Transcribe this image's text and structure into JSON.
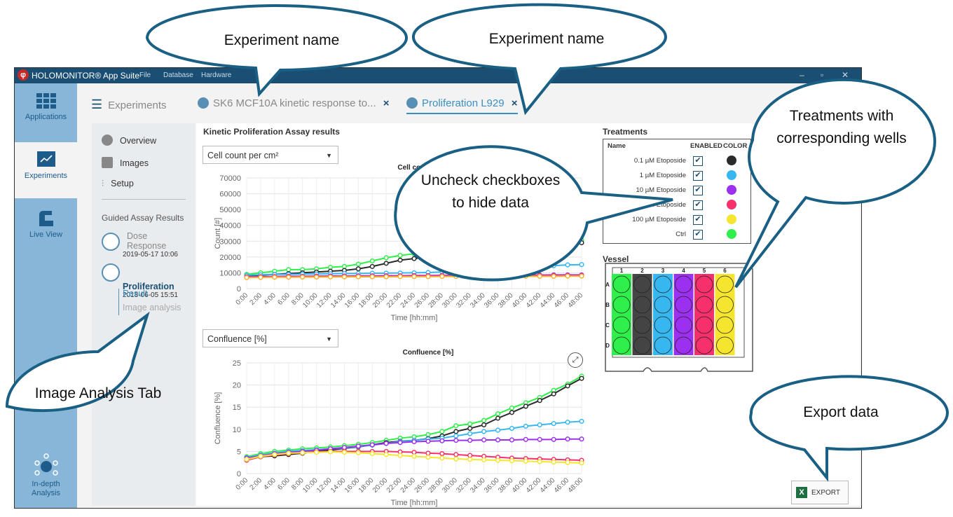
{
  "window": {
    "app_title": "HOLOMONITOR® App Suite",
    "menu": [
      "File",
      "Database",
      "Hardware"
    ]
  },
  "left_nav": [
    {
      "label": "Applications",
      "icon": "grid-icon"
    },
    {
      "label": "Experiments",
      "icon": "chart-icon"
    },
    {
      "label": "Live View",
      "icon": "microscope-icon"
    },
    {
      "label": "In-depth Analysis",
      "icon": "network-icon"
    }
  ],
  "tabs": {
    "experiments": "Experiments",
    "tab1": "SK6 MCF10A kinetic response to...",
    "tab2": "Proliferation L929",
    "close": "×"
  },
  "sidebar": {
    "overview": "Overview",
    "images": "Images",
    "setup": "Setup",
    "guided_heading": "Guided Assay Results",
    "dose_title": "Dose Response",
    "dose_date": "2019-05-17 10:06",
    "prolif_title": "Proliferation",
    "prolif_date": "2018-06-05 15:51",
    "result": "Result",
    "image_analysis": "Image analysis"
  },
  "main": {
    "heading": "Kinetic Proliferation Assay results",
    "select1": "Cell count per cm²",
    "select2": "Confluence [%]",
    "export_label": "EXPORT",
    "export_icon": "X"
  },
  "treatments": {
    "title": "Treatments",
    "col_name": "Name",
    "col_enabled": "ENABLED",
    "col_color": "COLOR",
    "rows": [
      {
        "name": "0.1 µM Etoposide",
        "enabled": true,
        "color": "#2a2a2a"
      },
      {
        "name": "1 µM Etoposide",
        "enabled": true,
        "color": "#37b7f0"
      },
      {
        "name": "10 µM Etoposide",
        "enabled": true,
        "color": "#9c30f0"
      },
      {
        "name": "50 µM Etoposide",
        "enabled": true,
        "color": "#f5306a"
      },
      {
        "name": "100 µM Etoposide",
        "enabled": true,
        "color": "#f5e52f"
      },
      {
        "name": "Ctrl",
        "enabled": true,
        "color": "#2ff04a"
      }
    ],
    "check": "✔"
  },
  "vessel": {
    "title": "Vessel",
    "cols": [
      "1",
      "2",
      "3",
      "4",
      "5",
      "6"
    ],
    "rows": [
      "A",
      "B",
      "C",
      "D"
    ],
    "col_colors": [
      "#2ff04a",
      "#444444",
      "#37b7f0",
      "#9c30f0",
      "#f5306a",
      "#f5e52f"
    ]
  },
  "callouts": {
    "exp_name_1": "Experiment name",
    "exp_name_2": "Experiment name",
    "treatments": "Treatments with corresponding wells",
    "uncheck": "Uncheck checkboxes to hide data",
    "image_tab": "Image Analysis Tab",
    "export": "Export data"
  },
  "chart_data": [
    {
      "type": "line",
      "title": "Cell count per cm²",
      "xlabel": "Time [hh:mm]",
      "ylabel": "Count [#]",
      "ylim": [
        0,
        70000
      ],
      "yticks": [
        0,
        10000,
        20000,
        30000,
        40000,
        50000,
        60000,
        70000
      ],
      "categories": [
        "0:00",
        "2:00",
        "4:00",
        "6:00",
        "8:00",
        "10:00",
        "12:00",
        "14:00",
        "16:00",
        "18:00",
        "20:00",
        "22:00",
        "24:00",
        "26:00",
        "28:00",
        "30:00",
        "32:00",
        "34:00",
        "36:00",
        "38:00",
        "40:00",
        "42:00",
        "44:00",
        "46:00",
        "48:00"
      ],
      "series": [
        {
          "name": "Ctrl",
          "color": "#2ff04a",
          "values": [
            9000,
            10000,
            11000,
            12000,
            12000,
            12500,
            13500,
            14000,
            15500,
            17500,
            19500,
            21000,
            22000,
            23000,
            24000,
            25000,
            26000,
            27000,
            27500,
            28000,
            28500,
            29000,
            29500,
            30000,
            30500
          ]
        },
        {
          "name": "0.1 µM Etoposide",
          "color": "#2a2a2a",
          "values": [
            8000,
            8500,
            9000,
            9500,
            10000,
            10500,
            11000,
            11500,
            12500,
            14000,
            16000,
            18000,
            19000,
            20000,
            21000,
            22000,
            23000,
            24000,
            25000,
            26000,
            27000,
            27500,
            28000,
            28500,
            29000
          ]
        },
        {
          "name": "1 µM Etoposide",
          "color": "#37b7f0",
          "values": [
            8500,
            8800,
            9000,
            9000,
            9200,
            9300,
            9400,
            9500,
            9600,
            9700,
            9800,
            9900,
            10000,
            10200,
            10500,
            11000,
            11500,
            12000,
            12500,
            13000,
            13500,
            14000,
            14500,
            15000,
            15200
          ]
        },
        {
          "name": "10 µM Etoposide",
          "color": "#9c30f0",
          "values": [
            7500,
            7600,
            7700,
            7800,
            7800,
            7900,
            8000,
            8000,
            8100,
            8100,
            8200,
            8200,
            8300,
            8300,
            8400,
            8400,
            8500,
            8500,
            8500,
            8600,
            8600,
            8600,
            8700,
            8700,
            8700
          ]
        },
        {
          "name": "50 µM Etoposide",
          "color": "#f5306a",
          "values": [
            7200,
            7300,
            7400,
            7500,
            7500,
            7600,
            7600,
            7700,
            7700,
            7800,
            7800,
            7900,
            7900,
            8000,
            8000,
            8000,
            8000,
            8100,
            8100,
            8100,
            8200,
            8200,
            8200,
            8200,
            8300
          ]
        },
        {
          "name": "100 µM Etoposide",
          "color": "#f5b02f",
          "values": [
            7000,
            7100,
            7200,
            7200,
            7300,
            7300,
            7400,
            7400,
            7500,
            7500,
            7500,
            7600,
            7600,
            7600,
            7700,
            7700,
            7700,
            7700,
            7800,
            7800,
            7800,
            7800,
            7800,
            7900,
            7900
          ]
        }
      ]
    },
    {
      "type": "line",
      "title": "Confluence [%]",
      "xlabel": "Time [hh:mm]",
      "ylabel": "Confluence [%]",
      "ylim": [
        0,
        25
      ],
      "yticks": [
        0,
        5,
        10,
        15,
        20,
        25
      ],
      "categories": [
        "0:00",
        "2:00",
        "4:00",
        "6:00",
        "8:00",
        "10:00",
        "12:00",
        "14:00",
        "16:00",
        "18:00",
        "20:00",
        "22:00",
        "24:00",
        "26:00",
        "28:00",
        "30:00",
        "32:00",
        "34:00",
        "36:00",
        "38:00",
        "40:00",
        "42:00",
        "44:00",
        "46:00",
        "48:00"
      ],
      "series": [
        {
          "name": "Ctrl",
          "color": "#2ff04a",
          "values": [
            3.8,
            4.5,
            5.0,
            5.3,
            5.6,
            5.8,
            6.0,
            6.3,
            6.6,
            7.0,
            7.5,
            8.0,
            8.3,
            8.8,
            9.5,
            10.8,
            11.2,
            12.0,
            13.5,
            14.8,
            16.0,
            17.2,
            18.8,
            20.2,
            22.0
          ]
        },
        {
          "name": "0.1 µM Etoposide",
          "color": "#2a2a2a",
          "values": [
            3.5,
            3.8,
            4.0,
            4.3,
            4.6,
            5.0,
            5.3,
            5.7,
            6.0,
            6.5,
            7.0,
            7.3,
            7.5,
            7.9,
            8.5,
            9.5,
            10.2,
            11.0,
            12.5,
            13.8,
            15.2,
            16.5,
            18.0,
            19.8,
            21.5
          ]
        },
        {
          "name": "1 µM Etoposide",
          "color": "#37b7f0",
          "values": [
            3.6,
            4.2,
            4.6,
            5.0,
            5.2,
            5.4,
            5.6,
            5.8,
            6.1,
            6.4,
            6.8,
            7.2,
            7.5,
            7.8,
            8.0,
            8.5,
            9.0,
            9.5,
            9.8,
            10.2,
            10.7,
            11.0,
            11.3,
            11.6,
            11.8
          ]
        },
        {
          "name": "10 µM Etoposide",
          "color": "#9c30f0",
          "values": [
            3.5,
            4.0,
            4.5,
            4.8,
            5.0,
            5.3,
            5.6,
            5.9,
            6.2,
            6.5,
            6.8,
            7.0,
            7.2,
            7.3,
            7.4,
            7.5,
            7.5,
            7.6,
            7.6,
            7.6,
            7.7,
            7.7,
            7.7,
            7.8,
            7.8
          ]
        },
        {
          "name": "50 µM Etoposide",
          "color": "#f5306a",
          "values": [
            3.0,
            3.8,
            4.2,
            4.5,
            4.7,
            4.9,
            5.0,
            5.0,
            5.0,
            5.0,
            5.0,
            4.9,
            4.8,
            4.6,
            4.5,
            4.3,
            4.1,
            3.9,
            3.7,
            3.5,
            3.4,
            3.3,
            3.2,
            3.1,
            3.0
          ]
        },
        {
          "name": "100 µM Etoposide",
          "color": "#f5e52f",
          "values": [
            3.2,
            3.9,
            4.3,
            4.6,
            4.7,
            4.8,
            4.9,
            4.8,
            4.7,
            4.5,
            4.3,
            4.1,
            3.9,
            3.7,
            3.5,
            3.3,
            3.2,
            3.1,
            3.0,
            2.9,
            2.8,
            2.7,
            2.6,
            2.5,
            2.4
          ]
        }
      ]
    }
  ]
}
